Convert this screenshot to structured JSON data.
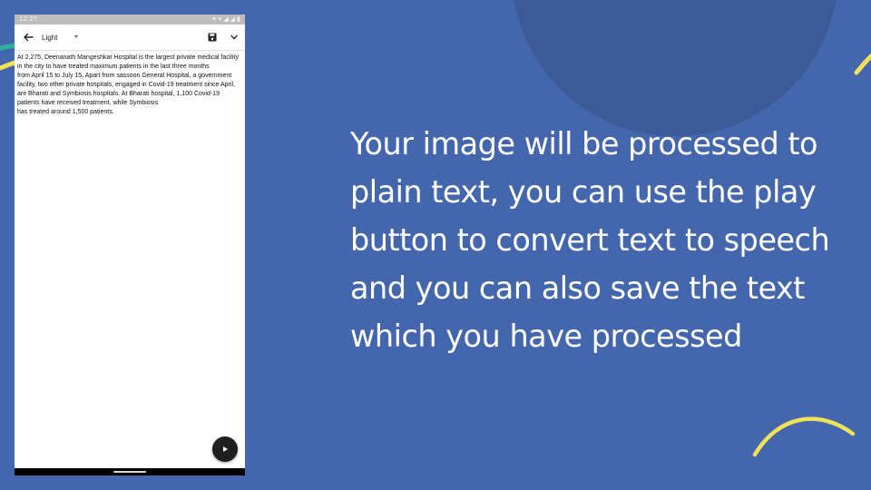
{
  "phone": {
    "status_time": "12:27",
    "status_icons": [
      "settings-icon",
      "wifi-icon",
      "signal-icon",
      "battery-icon"
    ],
    "toolbar": {
      "back_icon": "arrow-left-icon",
      "theme_selected": "Light",
      "save_icon": "floppy-disk-icon",
      "more_icon": "chevron-down-icon"
    },
    "ocr_text": "At 2,275, Deenanath Mangeshkar Hospital is the largest private medical facility in the city to have treated maximum patients in the last three months\nfrom April 15 to July 15. Apart from sassoon General Hospital, a government facility, two other private hospitals, engaged in Covid-19 treatment since April, are Bharati and Symbiosis hospitals. At Bharati hospital, 1,100 Covid-19 patients have received treatment, while Symbiosis\nhas treated around 1,500 patients.",
    "play_icon": "play-icon"
  },
  "description": "Your image will be processed to plain text, you can use the play button to convert text to speech and you can also save the text which you have processed",
  "colors": {
    "background": "#4466ad",
    "accent_circle": "#3c5a98",
    "yellow_accent": "#f1e05a",
    "teal_accent": "#2bb39a",
    "fab": "#1f1f1f"
  }
}
